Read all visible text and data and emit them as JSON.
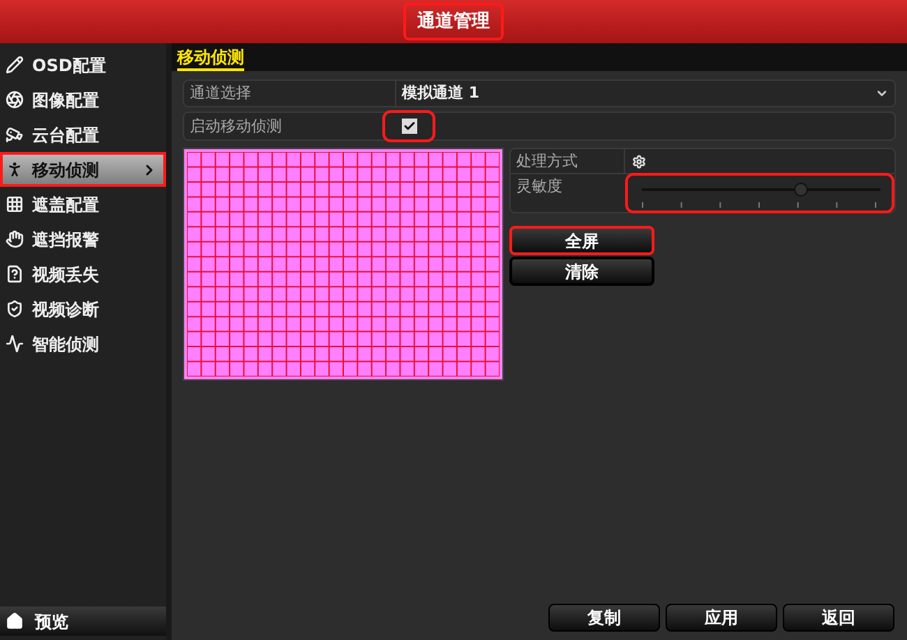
{
  "header": {
    "title": "通道管理",
    "highlighted": true
  },
  "sidebar": {
    "items": [
      {
        "label": "OSD配置",
        "selected": false,
        "highlighted": false
      },
      {
        "label": "图像配置",
        "selected": false,
        "highlighted": false
      },
      {
        "label": "云台配置",
        "selected": false,
        "highlighted": false
      },
      {
        "label": "移动侦测",
        "selected": true,
        "highlighted": true
      },
      {
        "label": "遮盖配置",
        "selected": false,
        "highlighted": false
      },
      {
        "label": "遮挡报警",
        "selected": false,
        "highlighted": false
      },
      {
        "label": "视频丢失",
        "selected": false,
        "highlighted": false
      },
      {
        "label": "视频诊断",
        "selected": false,
        "highlighted": false
      },
      {
        "label": "智能侦测",
        "selected": false,
        "highlighted": false
      }
    ],
    "footer": {
      "label": "预览"
    }
  },
  "tab": {
    "label": "移动侦测"
  },
  "channel": {
    "label": "通道选择",
    "value": "模拟通道 1"
  },
  "enable": {
    "label": "启动移动侦测",
    "checked": true,
    "highlighted": true
  },
  "motion_area": {
    "all_selected": true
  },
  "handling": {
    "label": "处理方式"
  },
  "sensitivity": {
    "label": "灵敏度",
    "level": 0.667,
    "highlighted": true
  },
  "side_buttons": [
    {
      "label": "全屏",
      "highlighted": true
    },
    {
      "label": "清除",
      "highlighted": false
    }
  ],
  "footer_buttons": [
    "复制",
    "应用",
    "返回"
  ]
}
